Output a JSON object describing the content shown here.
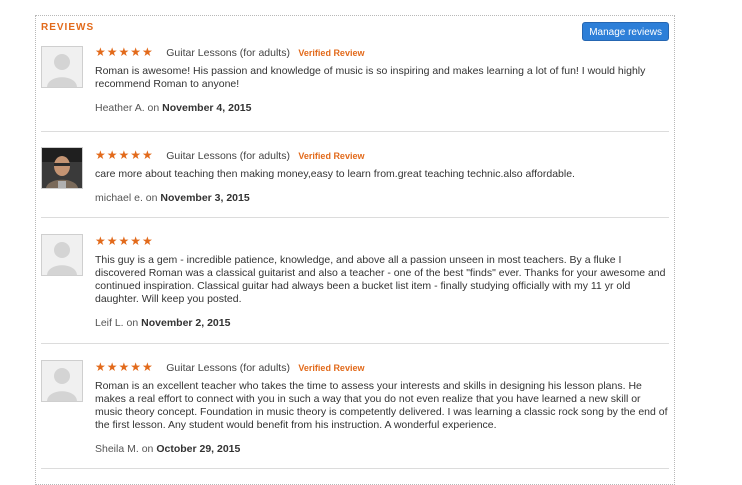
{
  "section": {
    "title": "REVIEWS",
    "manage_label": "Manage reviews"
  },
  "colors": {
    "accent": "#e26a1b",
    "button": "#2d7fd8"
  },
  "reviews": [
    {
      "stars": "★★★★★",
      "course": "Guitar Lessons (for adults)",
      "verified": "Verified Review",
      "text": "Roman is awesome! His passion and knowledge of music is so inspiring and makes learning a lot of fun! I would highly recommend Roman to anyone!",
      "author": "Heather A.",
      "on": "on",
      "date": "November 4, 2015",
      "avatar": "default-avatar-icon"
    },
    {
      "stars": "★★★★★",
      "course": "Guitar Lessons (for adults)",
      "verified": "Verified Review",
      "text": "care more about teaching then making money,easy to learn from.great teaching technic.also affordable.",
      "author": "michael e.",
      "on": "on",
      "date": "November 3, 2015",
      "avatar": "user-photo"
    },
    {
      "stars": "★★★★★",
      "course": "",
      "verified": "",
      "text": "This guy is a gem - incredible patience, knowledge, and above all a passion unseen in most teachers. By a fluke I discovered Roman was a classical guitarist and also a teacher - one of the best \"finds\" ever. Thanks for your awesome and continued inspiration. Classical guitar had always been a bucket list item - finally studying officially with my 11 yr old daughter. Will keep you posted.",
      "author": "Leif L.",
      "on": "on",
      "date": "November 2, 2015",
      "avatar": "default-avatar-icon"
    },
    {
      "stars": "★★★★★",
      "course": "Guitar Lessons (for adults)",
      "verified": "Verified Review",
      "text": "Roman is an excellent teacher who takes the time to assess your interests and skills in designing his lesson plans. He makes a real effort to connect with you in such a way that you do not even realize that you have learned a new skill or music theory concept. Foundation in music theory is competently delivered. I was learning a classic rock song by the end of the first lesson. Any student would benefit from his instruction. A wonderful experience.",
      "author": "Sheila M.",
      "on": "on",
      "date": "October 29, 2015",
      "avatar": "default-avatar-icon"
    }
  ]
}
